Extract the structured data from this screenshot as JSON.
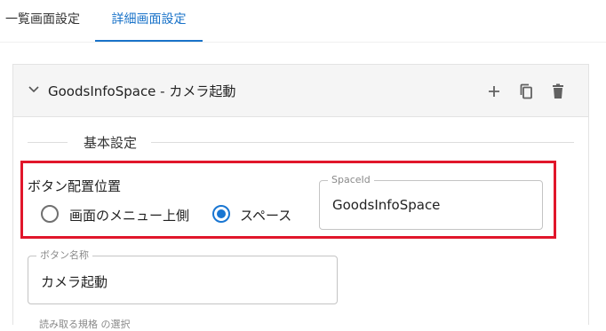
{
  "tabs": [
    {
      "label": "一覧画面設定",
      "active": false
    },
    {
      "label": "詳細画面設定",
      "active": true
    }
  ],
  "panel": {
    "title": "GoodsInfoSpace - カメラ起動",
    "expand_icon": "chevron-down-icon",
    "actions": {
      "add_icon": "plus-icon",
      "copy_icon": "copy-icon",
      "delete_icon": "trash-icon"
    }
  },
  "section": {
    "title": "基本設定"
  },
  "button_position": {
    "label": "ボタン配置位置",
    "options": [
      {
        "label": "画面のメニュー上側",
        "checked": false
      },
      {
        "label": "スペース",
        "checked": true
      }
    ]
  },
  "space_id": {
    "label": "SpaceId",
    "value": "GoodsInfoSpace"
  },
  "button_name": {
    "label": "ボタン名称",
    "value": "カメラ起動"
  },
  "next_field": {
    "label": "読み取る規格 の選択"
  },
  "colors": {
    "accent": "#1976d2",
    "highlight_border": "#e1162b",
    "header_bg": "#f5f5f5"
  }
}
